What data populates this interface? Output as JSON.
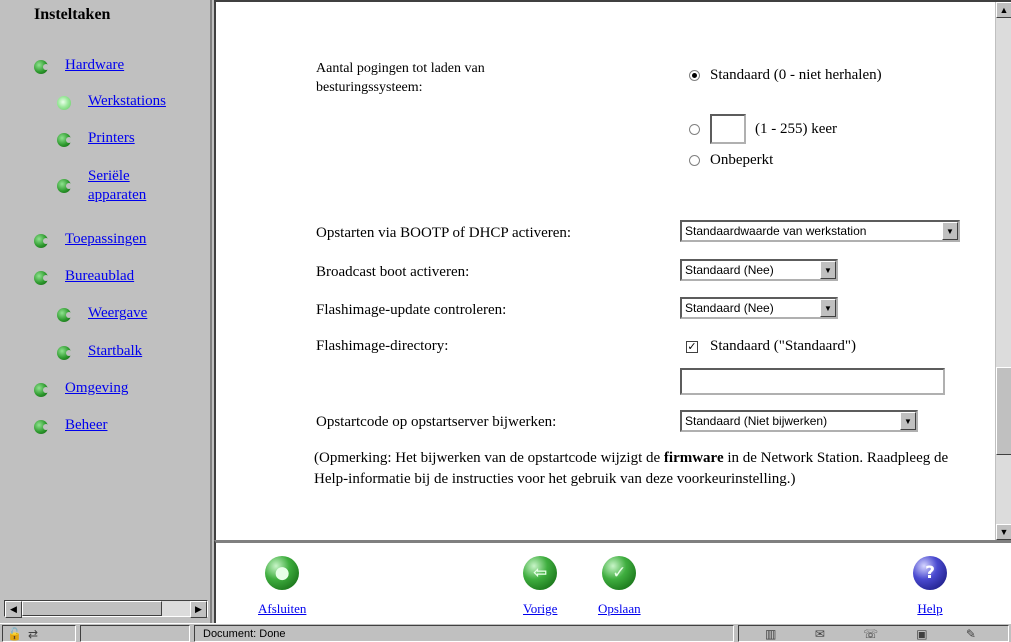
{
  "nav": {
    "title": "Insteltaken",
    "items": [
      {
        "label": "Hardware"
      },
      {
        "label": "Werkstations"
      },
      {
        "label": "Printers"
      },
      {
        "label": "Seriële apparaten"
      },
      {
        "label": "Toepassingen"
      },
      {
        "label": "Bureaublad"
      },
      {
        "label": "Weergave"
      },
      {
        "label": "Startbalk"
      },
      {
        "label": "Omgeving"
      },
      {
        "label": "Beheer"
      }
    ]
  },
  "form": {
    "boot_attempts": {
      "label": "Aantal pogingen tot laden van besturingssysteem:",
      "option_default": "Standaard (0 - niet herhalen)",
      "option_custom_range": "(1 - 255) keer",
      "option_unlimited": "Onbeperkt",
      "custom_value": ""
    },
    "bootp_dhcp": {
      "label": "Opstarten via BOOTP of DHCP activeren:",
      "value": "Standaardwaarde van werkstation"
    },
    "broadcast_boot": {
      "label": "Broadcast boot activeren:",
      "value": "Standaard (Nee)"
    },
    "flash_update": {
      "label": "Flashimage-update controleren:",
      "value": "Standaard (Nee)"
    },
    "flash_dir": {
      "label": "Flashimage-directory:",
      "checkbox_label": "Standaard (\"Standaard\")",
      "checked": true,
      "value": ""
    },
    "bootcode_update": {
      "label": "Opstartcode op opstartserver bijwerken:",
      "value": "Standaard (Niet bijwerken)"
    },
    "note_before": "(Opmerking: Het bijwerken van de opstartcode wijzigt de ",
    "note_bold": "firmware",
    "note_after": " in de Network Station. Raadpleeg de Help-informatie bij de instructies voor het gebruik van deze voorkeurinstelling.)"
  },
  "toolbar": {
    "close_label": "Afsluiten",
    "prev_label": "Vorige",
    "save_label": "Opslaan",
    "help_label": "Help"
  },
  "status": {
    "text": "Document: Done"
  },
  "colors": {
    "link": "#0000ee",
    "panel": "#c0c0c0",
    "bullet_green": "#2e9a2e"
  }
}
